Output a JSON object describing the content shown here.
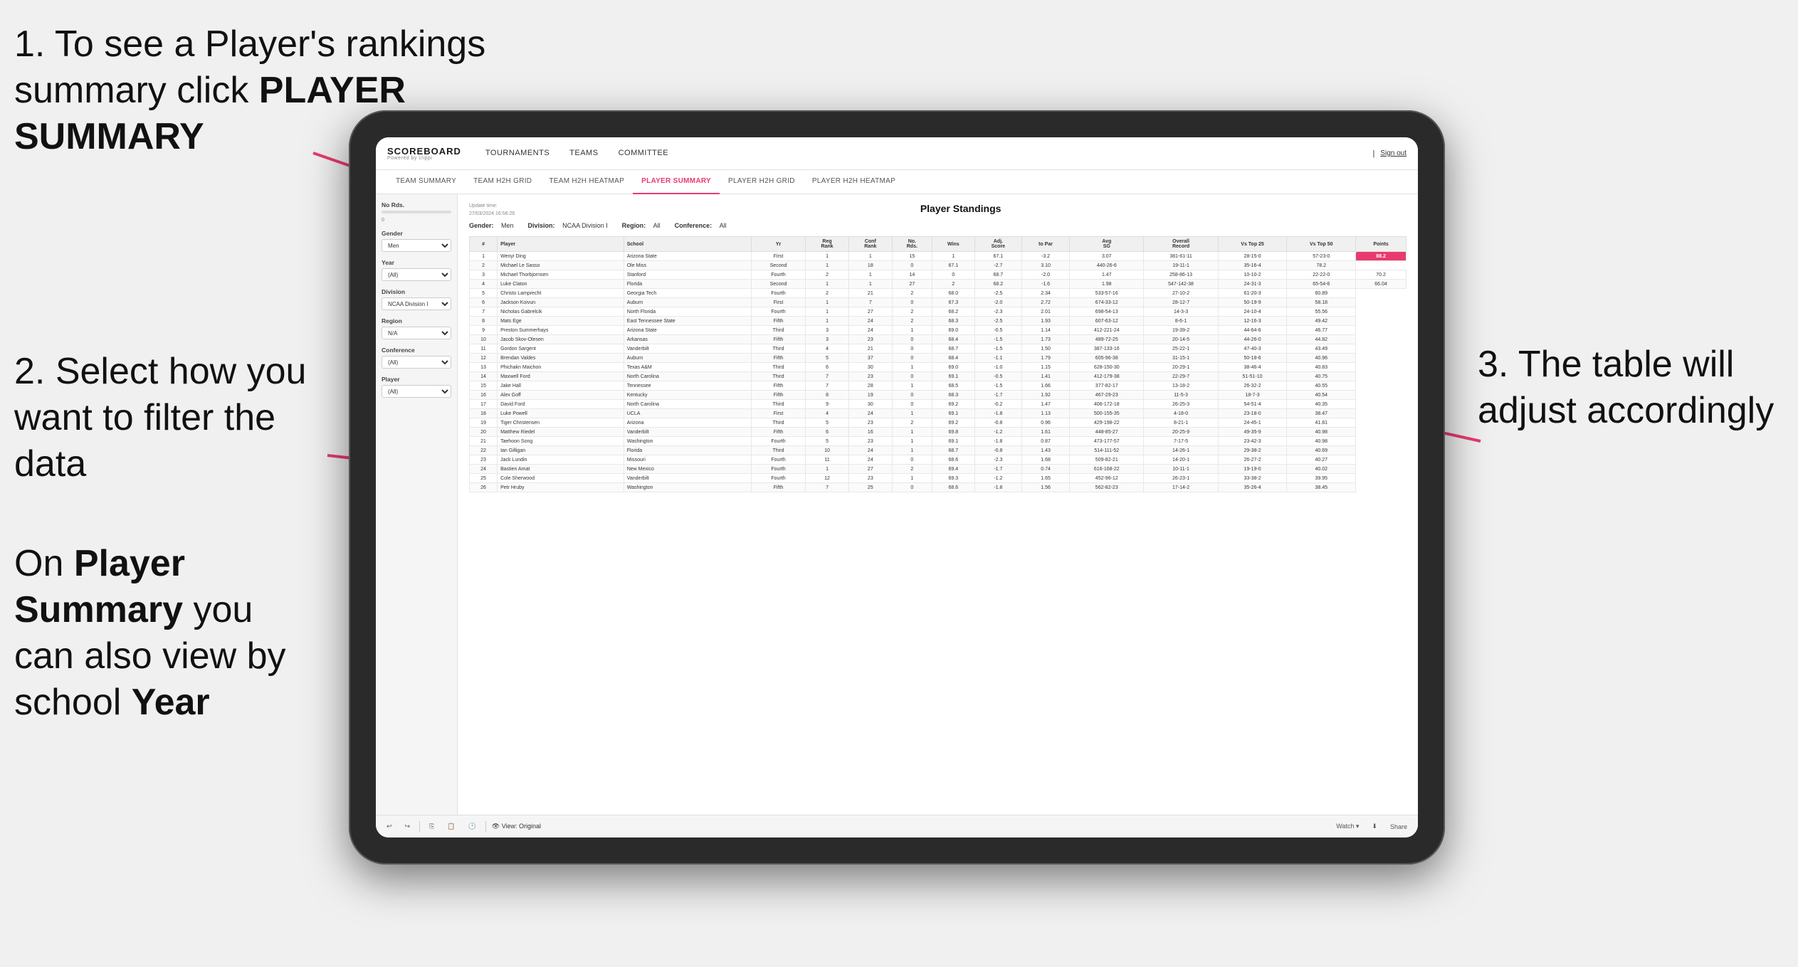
{
  "annotations": {
    "top_left": {
      "number": "1.",
      "text": "To see a Player's rankings summary click ",
      "bold": "PLAYER SUMMARY"
    },
    "mid_left": {
      "number": "2.",
      "text": "Select how you want to filter the data"
    },
    "bottom_left": {
      "text": "On ",
      "bold1": "Player Summary",
      "text2": " you can also view by school ",
      "bold2": "Year"
    },
    "right": {
      "number": "3.",
      "text": " The table will adjust accordingly"
    }
  },
  "nav": {
    "logo_main": "SCOREBOARD",
    "logo_sub": "Powered by clippi",
    "items": [
      "TOURNAMENTS",
      "TEAMS",
      "COMMITTEE"
    ],
    "sign_out": "Sign out"
  },
  "sub_nav": {
    "items": [
      "TEAM SUMMARY",
      "TEAM H2H GRID",
      "TEAM H2H HEATMAP",
      "PLAYER SUMMARY",
      "PLAYER H2H GRID",
      "PLAYER H2H HEATMAP"
    ],
    "active": "PLAYER SUMMARY"
  },
  "filters": {
    "no_rds_label": "No Rds.",
    "gender_label": "Gender",
    "gender_value": "Men",
    "year_label": "Year",
    "year_value": "(All)",
    "division_label": "Division",
    "division_value": "NCAA Division I",
    "region_label": "Region",
    "region_value": "N/A",
    "conference_label": "Conference",
    "conference_value": "(All)",
    "player_label": "Player",
    "player_value": "(All)"
  },
  "table": {
    "title": "Player Standings",
    "update_time": "Update time:\n27/03/2024 16:56:26",
    "gender_label": "Gender:",
    "gender_value": "Men",
    "division_label": "Division:",
    "division_value": "NCAA Division I",
    "region_label": "Region:",
    "region_value": "All",
    "conference_label": "Conference:",
    "conference_value": "All",
    "columns": [
      "#",
      "Player",
      "School",
      "Yr",
      "Reg Rank",
      "Conf Rank",
      "No. Rds.",
      "Wins",
      "Adj. Score to Par",
      "Avg SG",
      "Overall Record",
      "Vs Top 25",
      "Vs Top 50",
      "Points"
    ],
    "rows": [
      [
        1,
        "Wenyi Ding",
        "Arizona State",
        "First",
        1,
        1,
        15,
        1,
        "67.1",
        "-3.2",
        "3.07",
        "381-61-11",
        "28-15-0",
        "57-23-0",
        "88.2"
      ],
      [
        2,
        "Michael Le Sasso",
        "Ole Miss",
        "Second",
        1,
        18,
        0,
        "67.1",
        "-2.7",
        "3.10",
        "440-26-6",
        "19-11-1",
        "35-16-4",
        "78.2"
      ],
      [
        3,
        "Michael Thorbjornsen",
        "Stanford",
        "Fourth",
        2,
        1,
        14,
        0,
        "68.7",
        "-2.0",
        "1.47",
        "258-86-13",
        "10-10-2",
        "22-22-0",
        "70.2"
      ],
      [
        4,
        "Luke Claton",
        "Florida",
        "Second",
        1,
        1,
        27,
        2,
        "68.2",
        "-1.6",
        "1.98",
        "547-142-38",
        "24-31-3",
        "65-54-6",
        "66.04"
      ],
      [
        5,
        "Christo Lamprecht",
        "Georgia Tech",
        "Fourth",
        2,
        21,
        2,
        "68.0",
        "-2.5",
        "2.34",
        "533-57-16",
        "27-10-2",
        "61-20-3",
        "60.89"
      ],
      [
        6,
        "Jackson Koivun",
        "Auburn",
        "First",
        1,
        7,
        0,
        "67.3",
        "-2.0",
        "2.72",
        "674-33-12",
        "28-12-7",
        "50-19-9",
        "58.18"
      ],
      [
        7,
        "Nicholas Gabrelcik",
        "North Florida",
        "Fourth",
        1,
        27,
        2,
        "68.2",
        "-2.3",
        "2.01",
        "698-54-13",
        "14-3-3",
        "24-10-4",
        "55.56"
      ],
      [
        8,
        "Mats Ege",
        "East Tennessee State",
        "Fifth",
        1,
        24,
        2,
        "68.3",
        "-2.5",
        "1.93",
        "607-63-12",
        "8-6-1",
        "12-16-3",
        "49.42"
      ],
      [
        9,
        "Preston Summerhays",
        "Arizona State",
        "Third",
        3,
        24,
        1,
        "69.0",
        "-0.5",
        "1.14",
        "412-221-24",
        "19-39-2",
        "44-64-6",
        "46.77"
      ],
      [
        10,
        "Jacob Skov-Olesen",
        "Arkansas",
        "Fifth",
        3,
        23,
        0,
        "68.4",
        "-1.5",
        "1.73",
        "489-72-25",
        "20-14-5",
        "44-26-0",
        "44.82"
      ],
      [
        11,
        "Gordon Sargent",
        "Vanderbilt",
        "Third",
        4,
        21,
        0,
        "68.7",
        "-1.5",
        "1.50",
        "387-133-16",
        "25-22-1",
        "47-40-3",
        "43.49"
      ],
      [
        12,
        "Brendan Valdes",
        "Auburn",
        "Fifth",
        5,
        37,
        0,
        "68.4",
        "-1.1",
        "1.79",
        "605-96-38",
        "31-15-1",
        "50-18-6",
        "40.96"
      ],
      [
        13,
        "Phichakn Maichon",
        "Texas A&M",
        "Third",
        6,
        30,
        1,
        "69.0",
        "-1.0",
        "1.15",
        "628-150-30",
        "20-29-1",
        "38-46-4",
        "40.83"
      ],
      [
        14,
        "Maxwell Ford",
        "North Carolina",
        "Third",
        7,
        23,
        0,
        "69.1",
        "-0.5",
        "1.41",
        "412-179-38",
        "22-29-7",
        "51-51-10",
        "40.75"
      ],
      [
        15,
        "Jake Hall",
        "Tennessee",
        "Fifth",
        7,
        28,
        1,
        "68.5",
        "-1.5",
        "1.66",
        "377-82-17",
        "13-18-2",
        "26-32-2",
        "40.55"
      ],
      [
        16,
        "Alex Goff",
        "Kentucky",
        "Fifth",
        8,
        19,
        0,
        "68.3",
        "-1.7",
        "1.92",
        "467-29-23",
        "11-5-3",
        "18-7-3",
        "40.54"
      ],
      [
        17,
        "David Ford",
        "North Carolina",
        "Third",
        9,
        30,
        0,
        "69.2",
        "-0.2",
        "1.47",
        "406-172-18",
        "26-25-3",
        "54-51-4",
        "40.35"
      ],
      [
        18,
        "Luke Powell",
        "UCLA",
        "First",
        4,
        24,
        1,
        "69.1",
        "-1.8",
        "1.13",
        "500-155-35",
        "4-18-0",
        "23-18-0",
        "38.47"
      ],
      [
        19,
        "Tiger Christensen",
        "Arizona",
        "Third",
        5,
        23,
        2,
        "69.2",
        "-0.8",
        "0.96",
        "429-198-22",
        "8-21-1",
        "24-45-1",
        "41.81"
      ],
      [
        20,
        "Matthew Riedel",
        "Vanderbilt",
        "Fifth",
        6,
        16,
        1,
        "69.8",
        "-1.2",
        "1.61",
        "448-85-27",
        "20-25-9",
        "49-35-9",
        "40.98"
      ],
      [
        21,
        "Taehoon Song",
        "Washington",
        "Fourth",
        5,
        23,
        1,
        "69.1",
        "-1.8",
        "0.87",
        "473-177-57",
        "7-17-5",
        "23-42-3",
        "40.98"
      ],
      [
        22,
        "Ian Gilligan",
        "Florida",
        "Third",
        10,
        24,
        1,
        "68.7",
        "-0.8",
        "1.43",
        "514-111-52",
        "14-26-1",
        "29-38-2",
        "40.69"
      ],
      [
        23,
        "Jack Lundin",
        "Missouri",
        "Fourth",
        11,
        24,
        0,
        "68.6",
        "-2.3",
        "1.68",
        "509-82-21",
        "14-20-1",
        "26-27-2",
        "40.27"
      ],
      [
        24,
        "Bastien Amat",
        "New Mexico",
        "Fourth",
        1,
        27,
        2,
        "69.4",
        "-1.7",
        "0.74",
        "616-168-22",
        "10-11-1",
        "19-19-0",
        "40.02"
      ],
      [
        25,
        "Cole Sherwood",
        "Vanderbilt",
        "Fourth",
        12,
        23,
        1,
        "69.3",
        "-1.2",
        "1.65",
        "452-96-12",
        "26-23-1",
        "33-38-2",
        "39.95"
      ],
      [
        26,
        "Petr Hruby",
        "Washington",
        "Fifth",
        7,
        25,
        0,
        "68.6",
        "-1.8",
        "1.56",
        "562-82-23",
        "17-14-2",
        "35-26-4",
        "38.45"
      ]
    ]
  },
  "toolbar": {
    "view_label": "View: Original",
    "watch_label": "Watch",
    "share_label": "Share"
  }
}
